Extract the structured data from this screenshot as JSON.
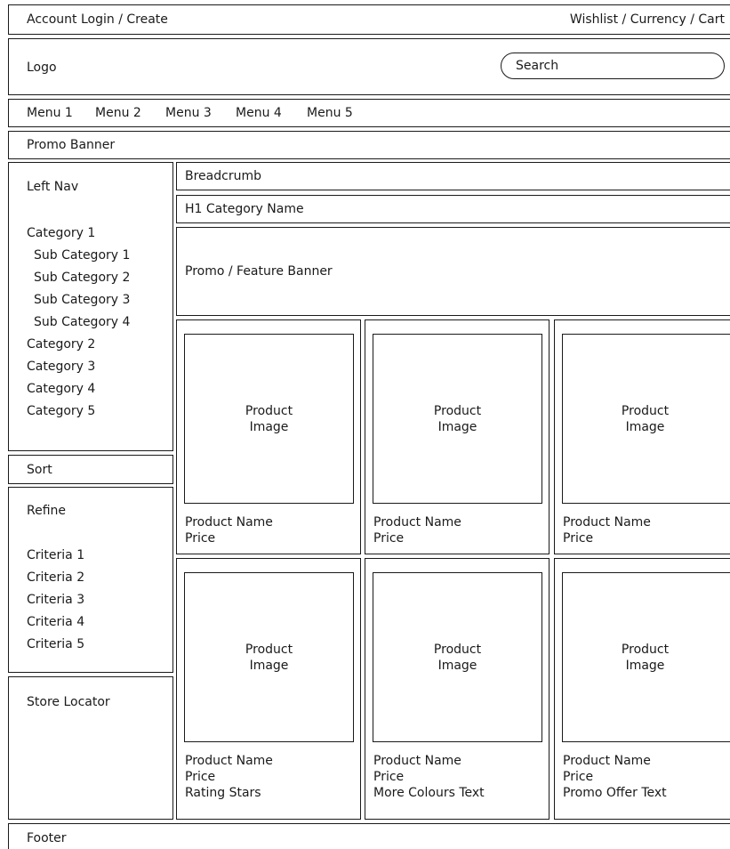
{
  "topbar": {
    "account_link": "Account Login / Create",
    "utility_links": "Wishlist / Currency / Cart"
  },
  "header": {
    "logo": "Logo",
    "search_placeholder": "Search"
  },
  "menu": {
    "items": [
      "Menu 1",
      "Menu 2",
      "Menu 3",
      "Menu 4",
      "Menu 5"
    ]
  },
  "promo_banner": "Promo Banner",
  "left_nav": {
    "title": "Left Nav",
    "items": [
      {
        "label": "Category 1"
      },
      {
        "label": "Sub Category 1"
      },
      {
        "label": "Sub Category 2"
      },
      {
        "label": "Sub Category 3"
      },
      {
        "label": "Sub Category 4"
      },
      {
        "label": "Category 2"
      },
      {
        "label": "Category 3"
      },
      {
        "label": "Category 4"
      },
      {
        "label": "Category 5"
      }
    ]
  },
  "sort": {
    "label": "Sort"
  },
  "refine": {
    "title": "Refine",
    "criteria": [
      "Criteria 1",
      "Criteria 2",
      "Criteria 3",
      "Criteria 4",
      "Criteria 5"
    ]
  },
  "store_locator": {
    "label": "Store Locator"
  },
  "breadcrumb": "Breadcrumb",
  "h1": "H1 Category Name",
  "feature_banner": "Promo / Feature Banner",
  "products": [
    {
      "image_line1": "Product",
      "image_line2": "Image",
      "lines": [
        "Product Name",
        "Price"
      ]
    },
    {
      "image_line1": "Product",
      "image_line2": "Image",
      "lines": [
        "Product Name",
        "Price"
      ]
    },
    {
      "image_line1": "Product",
      "image_line2": "Image",
      "lines": [
        "Product Name",
        "Price"
      ]
    },
    {
      "image_line1": "Product",
      "image_line2": "Image",
      "lines": [
        "Product Name",
        "Price",
        "Rating Stars"
      ]
    },
    {
      "image_line1": "Product",
      "image_line2": "Image",
      "lines": [
        "Product Name",
        "Price",
        "More Colours Text"
      ]
    },
    {
      "image_line1": "Product",
      "image_line2": "Image",
      "lines": [
        "Product Name",
        "Price",
        "Promo Offer Text"
      ]
    }
  ],
  "footer": "Footer"
}
